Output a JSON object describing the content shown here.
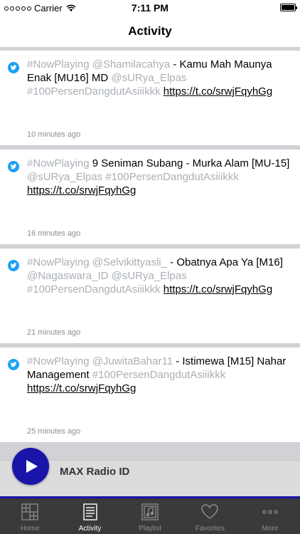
{
  "status_bar": {
    "carrier": "Carrier",
    "time": "7:11 PM"
  },
  "nav": {
    "title": "Activity"
  },
  "feed": [
    {
      "segments": [
        {
          "text": "#NowPlaying",
          "style": "muted"
        },
        {
          "text": " ",
          "style": "plain"
        },
        {
          "text": "@Shamilacahya",
          "style": "muted"
        },
        {
          "text": " - Kamu Mah Maunya Enak [MU16]  MD ",
          "style": "plain"
        },
        {
          "text": "@sURya_Elpas",
          "style": "muted"
        },
        {
          "text": " ",
          "style": "plain"
        },
        {
          "text": "#100PersenDangdutAsiiikkk",
          "style": "muted"
        },
        {
          "text": " ",
          "style": "plain"
        },
        {
          "text": "https://t.co/srwjFqyhGg",
          "style": "link"
        }
      ],
      "time": "10 minutes ago"
    },
    {
      "segments": [
        {
          "text": "#NowPlaying",
          "style": "muted"
        },
        {
          "text": " 9 Seniman Subang - Murka Alam [MU-15] ",
          "style": "plain"
        },
        {
          "text": "@sURya_Elpas",
          "style": "muted"
        },
        {
          "text": " ",
          "style": "plain"
        },
        {
          "text": "#100PersenDangdutAsiiikkk",
          "style": "muted"
        },
        {
          "text": " ",
          "style": "plain"
        },
        {
          "text": "https://t.co/srwjFqyhGg",
          "style": "link"
        }
      ],
      "time": "16 minutes ago"
    },
    {
      "segments": [
        {
          "text": "#NowPlaying",
          "style": "muted"
        },
        {
          "text": " ",
          "style": "plain"
        },
        {
          "text": "@Selvikittyasli_",
          "style": "muted"
        },
        {
          "text": " - Obatnya Apa Ya [M16] ",
          "style": "plain"
        },
        {
          "text": "@Nagaswara_ID",
          "style": "muted"
        },
        {
          "text": " ",
          "style": "plain"
        },
        {
          "text": "@sURya_Elpas",
          "style": "muted"
        },
        {
          "text": " ",
          "style": "plain"
        },
        {
          "text": "#100PersenDangdutAsiiikkk",
          "style": "muted"
        },
        {
          "text": " ",
          "style": "plain"
        },
        {
          "text": "https://t.co/srwjFqyhGg",
          "style": "link"
        }
      ],
      "time": "21 minutes ago"
    },
    {
      "segments": [
        {
          "text": "#NowPlaying",
          "style": "muted"
        },
        {
          "text": " ",
          "style": "plain"
        },
        {
          "text": "@JuwitaBahar11",
          "style": "muted"
        },
        {
          "text": " - Istimewa [M15] Nahar Management ",
          "style": "plain"
        },
        {
          "text": "#100PersenDangdutAsiiikkk",
          "style": "muted"
        },
        {
          "text": " ",
          "style": "plain"
        },
        {
          "text": "https://t.co/srwjFqyhGg",
          "style": "link"
        }
      ],
      "time": "25 minutes ago"
    }
  ],
  "player": {
    "station": "MAX Radio ID",
    "icon": "play-icon"
  },
  "tabs": [
    {
      "label": "Home",
      "icon": "home-grid-icon",
      "active": false
    },
    {
      "label": "Activity",
      "icon": "activity-list-icon",
      "active": true
    },
    {
      "label": "Playlist",
      "icon": "playlist-music-icon",
      "active": false
    },
    {
      "label": "Favorites",
      "icon": "heart-icon",
      "active": false
    },
    {
      "label": "More",
      "icon": "more-dots-icon",
      "active": false
    }
  ],
  "colors": {
    "accent": "#1a15a8",
    "twitter": "#1da1f2",
    "muted_text": "#aab0b6",
    "tabbar": "#3a3a3a"
  }
}
